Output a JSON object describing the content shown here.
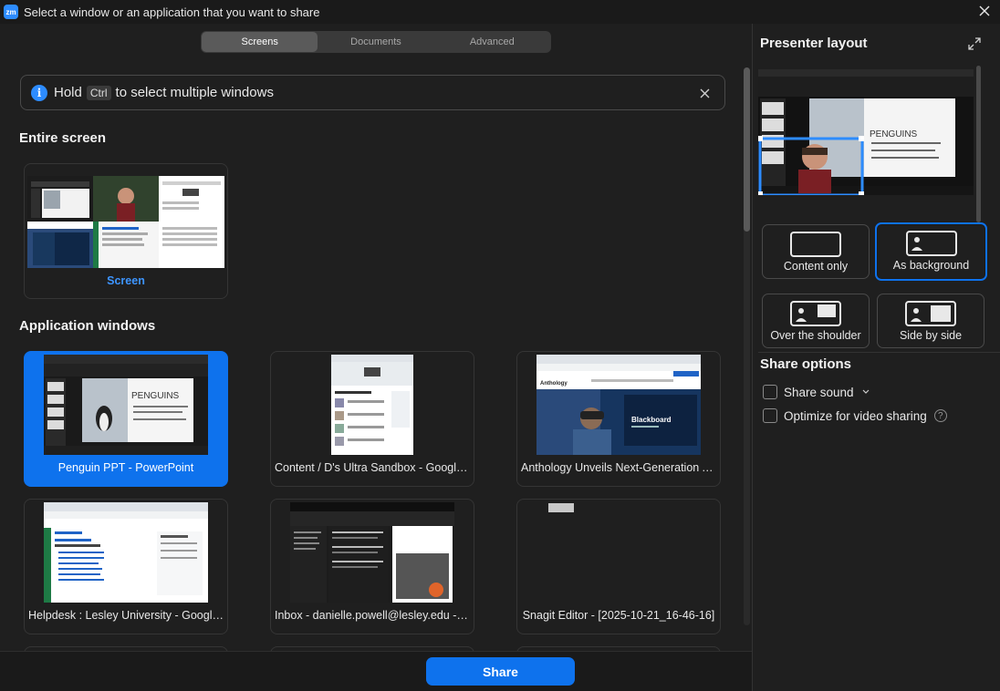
{
  "window": {
    "logo_text": "zm",
    "title": "Select a window or an application that you want to share"
  },
  "tabs": [
    {
      "label": "Screens",
      "active": true
    },
    {
      "label": "Documents",
      "active": false
    },
    {
      "label": "Advanced",
      "active": false
    }
  ],
  "banner": {
    "prefix": "Hold",
    "key": "Ctrl",
    "suffix": "to select multiple windows"
  },
  "entire_screen": {
    "heading": "Entire screen",
    "screen_label": "Screen"
  },
  "application_windows": {
    "heading": "Application windows",
    "items": [
      {
        "label": "Penguin PPT - PowerPoint",
        "selected": true
      },
      {
        "label": "Content / D's Ultra Sandbox - Google C...",
        "selected": false
      },
      {
        "label": "Anthology Unveils Next-Generation AI ...",
        "selected": false
      },
      {
        "label": "Helpdesk : Lesley University - Google C...",
        "selected": false
      },
      {
        "label": "Inbox - danielle.powell@lesley.edu - O...",
        "selected": false
      },
      {
        "label": "Snagit Editor - [2025-10-21_16-46-16]",
        "selected": false
      }
    ]
  },
  "thumb_text": {
    "ppt_slide_title": "PENGUINS",
    "blackboard_brand": "Blackboard",
    "anthology_brand": "Anthology"
  },
  "footer": {
    "share_label": "Share"
  },
  "presenter": {
    "heading": "Presenter layout",
    "slide_title": "PENGUINS",
    "layouts": [
      {
        "label": "Content only",
        "selected": false
      },
      {
        "label": "As background",
        "selected": true
      },
      {
        "label": "Over the shoulder",
        "selected": false
      },
      {
        "label": "Side by side",
        "selected": false
      }
    ]
  },
  "share_options": {
    "heading": "Share options",
    "share_sound": "Share sound",
    "optimize_video": "Optimize for video sharing",
    "help_glyph": "?"
  },
  "colors": {
    "accent": "#0e72ed",
    "background": "#1f1f1f",
    "link": "#3d95ff"
  }
}
